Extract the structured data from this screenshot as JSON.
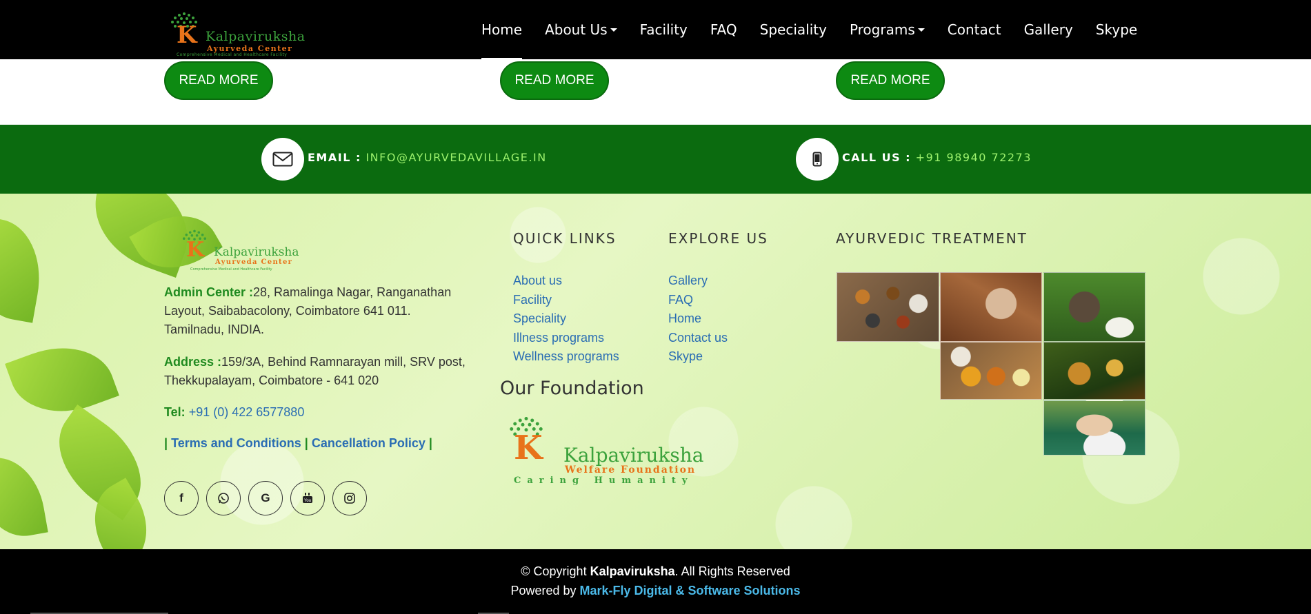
{
  "header": {
    "logo": {
      "name": "Kalpaviruksha",
      "sub": "Ayurveda Center",
      "tagline": "Comprehensive Medical and Healthcare Facility"
    },
    "menu": [
      {
        "label": "Home",
        "active": true,
        "dropdown": false
      },
      {
        "label": "About Us",
        "active": false,
        "dropdown": true
      },
      {
        "label": "Facility",
        "active": false,
        "dropdown": false
      },
      {
        "label": "FAQ",
        "active": false,
        "dropdown": false
      },
      {
        "label": "Speciality",
        "active": false,
        "dropdown": false
      },
      {
        "label": "Programs",
        "active": false,
        "dropdown": true
      },
      {
        "label": "Contact",
        "active": false,
        "dropdown": false
      },
      {
        "label": "Gallery",
        "active": false,
        "dropdown": false
      },
      {
        "label": "Skype",
        "active": false,
        "dropdown": false
      }
    ]
  },
  "cards": {
    "read_more": [
      "READ MORE",
      "READ MORE",
      "READ MORE"
    ]
  },
  "contact_bar": {
    "email_label": "EMAIL :",
    "email_value": "INFO@AYURVEDAVILLAGE.IN",
    "call_label": "CALL US :",
    "call_value": "+91 98940 72273",
    "email_icon": "envelope-icon",
    "phone_icon": "mobile-phone-icon"
  },
  "footer": {
    "logo": {
      "name": "Kalpaviruksha",
      "sub": "Ayurveda Center",
      "tagline": "Comprehensive Medical and Healthcare Facility"
    },
    "admin_label": "Admin Center :",
    "admin_value": "28, Ramalinga Nagar, Ranganathan Layout, Saibabacolony, Coimbatore 641 011. Tamilnadu, INDIA.",
    "address_label": "Address :",
    "address_value": "159/3A, Behind Ramnarayan mill, SRV post, Thekkupalayam, Coimbatore - 641 020",
    "tel_label": "Tel:",
    "tel_value": "+91 (0) 422 6577880",
    "policy_sep": "|",
    "terms": "Terms and Conditions",
    "cancellation": "Cancellation Policy",
    "social": [
      {
        "icon": "facebook-icon",
        "glyph": "f"
      },
      {
        "icon": "whatsapp-icon",
        "glyph": "✆"
      },
      {
        "icon": "google-icon",
        "glyph": "G"
      },
      {
        "icon": "youtube-icon",
        "glyph": "▶"
      },
      {
        "icon": "instagram-icon",
        "glyph": "◎"
      }
    ],
    "quick_links_title": "QUICK LINKS",
    "quick_links": [
      "About us",
      "Facility",
      "Speciality",
      "Illness programs",
      "Wellness programs"
    ],
    "explore_title": "EXPLORE US",
    "explore_links": [
      "Gallery",
      "FAQ",
      "Home",
      "Contact us",
      "Skype"
    ],
    "treatment_title": "AYURVEDIC TREATMENT",
    "foundation_title": "Our Foundation",
    "foundation_logo": {
      "name": "Kalpaviruksha",
      "sub": "Welfare Foundation",
      "tagline": "Caring Humanity"
    }
  },
  "bottom": {
    "copyright_prefix": "© Copyright ",
    "brand": "Kalpaviruksha",
    "copyright_suffix": ". All Rights Reserved",
    "powered_prefix": "Powered by ",
    "powered_by": "Mark-Fly Digital & Software Solutions"
  },
  "colors": {
    "header_bg": "#000000",
    "contact_bar_bg": "#0b6b0f",
    "button_green": "#0d8a12",
    "link_blue": "#2a6db3",
    "label_green": "#1f8a1f"
  }
}
